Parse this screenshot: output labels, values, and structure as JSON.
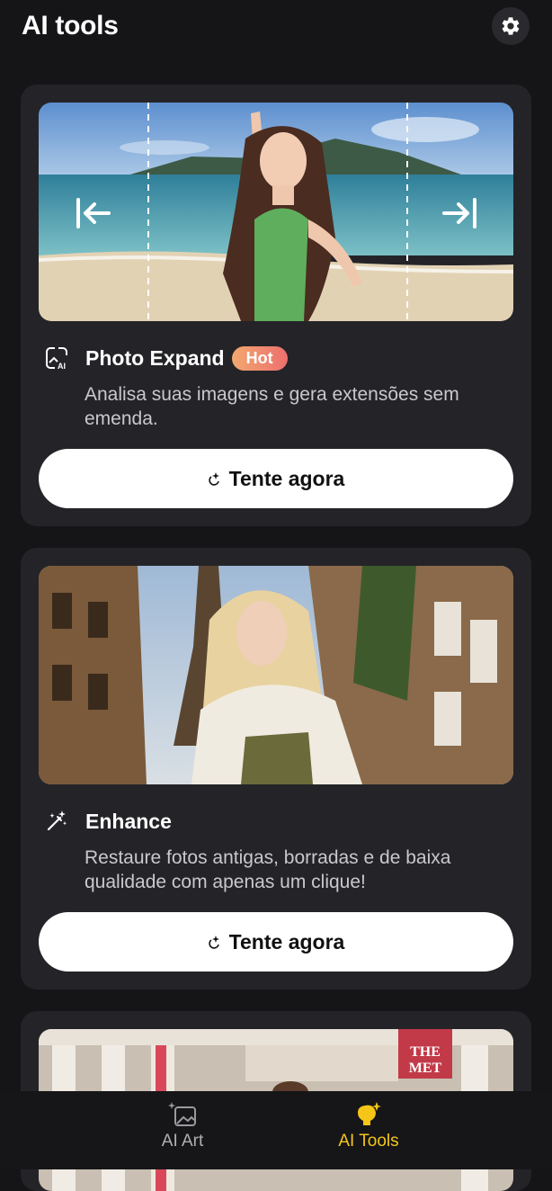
{
  "header": {
    "title": "AI tools"
  },
  "cards": [
    {
      "title": "Photo Expand",
      "badge": "Hot",
      "description": "Analisa suas imagens e gera extensões sem emenda.",
      "button_label": "Tente agora",
      "icon": "ai-image-expand-icon"
    },
    {
      "title": "Enhance",
      "description": "Restaure fotos antigas, borradas e de baixa qualidade com apenas um clique!",
      "button_label": "Tente agora",
      "icon": "magic-wand-icon"
    }
  ],
  "nav": {
    "items": [
      {
        "label": "AI Art",
        "icon": "ai-art-icon",
        "active": false
      },
      {
        "label": "AI Tools",
        "icon": "ai-tools-icon",
        "active": true
      }
    ]
  },
  "colors": {
    "background": "#151517",
    "card": "#242428",
    "accent": "#f5c518",
    "hot_badge": "#ec6f6f"
  }
}
